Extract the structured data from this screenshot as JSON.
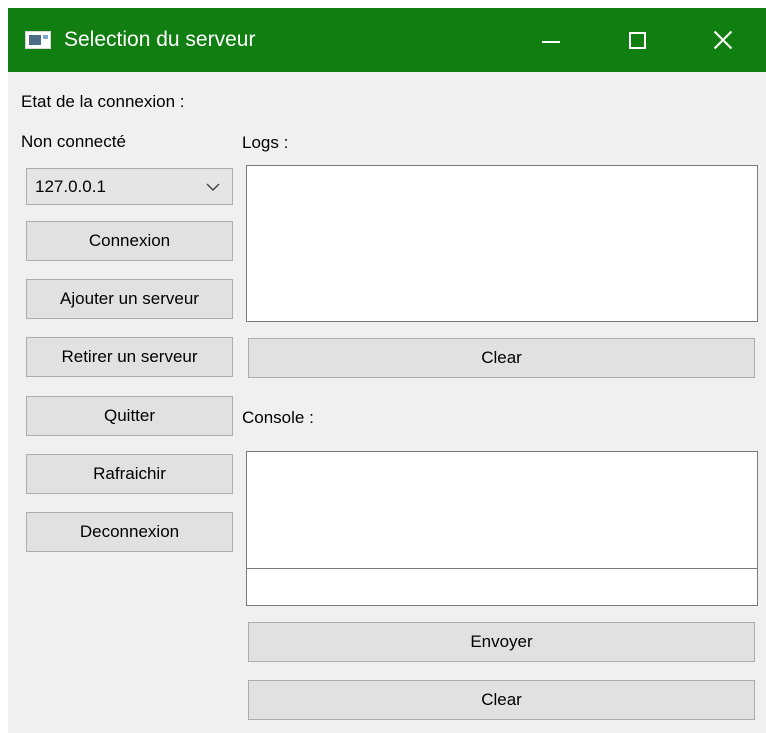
{
  "window": {
    "title": "Selection du serveur",
    "titlebar_color": "#117e11",
    "icons": {
      "app": "app-window-icon",
      "minimize": "minimize-icon",
      "maximize": "maximize-icon",
      "close": "close-icon"
    }
  },
  "connection": {
    "state_label": "Etat de la connexion :",
    "state_value": "Non connecté"
  },
  "server_select": {
    "selected": "127.0.0.1",
    "icon": "chevron-down-icon"
  },
  "left_buttons": {
    "connect": "Connexion",
    "add_server": "Ajouter un serveur",
    "remove_server": "Retirer un serveur",
    "quit": "Quitter",
    "refresh": "Rafraichir",
    "disconnect": "Deconnexion"
  },
  "logs": {
    "label": "Logs :",
    "content": "",
    "clear_label": "Clear"
  },
  "console": {
    "label": "Console :",
    "output": "",
    "input_value": "",
    "send_label": "Envoyer",
    "clear_label": "Clear"
  }
}
